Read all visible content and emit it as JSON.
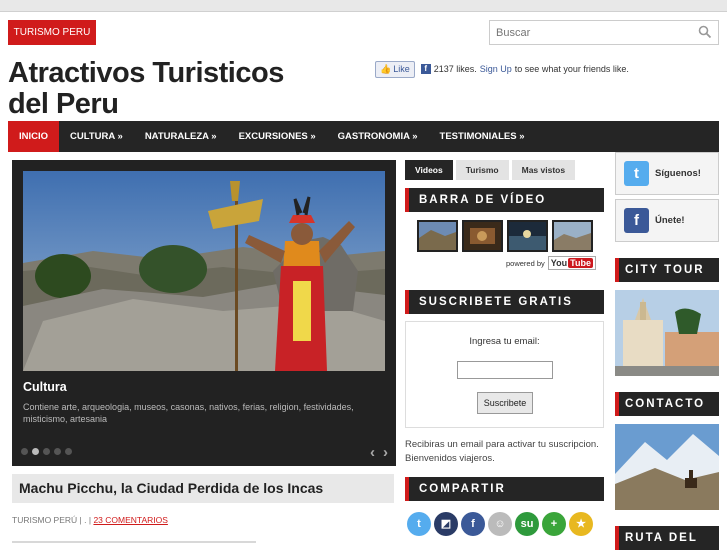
{
  "top_category": "TURISMO PERU",
  "search": {
    "placeholder": "Buscar"
  },
  "site": {
    "title_line1": "Atractivos Turisticos",
    "title_line2": "del Peru"
  },
  "facebook": {
    "like_label": "Like",
    "likes_text": "2137 likes.",
    "signup_label": "Sign Up",
    "signup_suffix": "to see what your friends like."
  },
  "nav": [
    {
      "label": "INICIO"
    },
    {
      "label": "CULTURA »"
    },
    {
      "label": "NATURALEZA »"
    },
    {
      "label": "EXCURSIONES »"
    },
    {
      "label": "GASTRONOMIA »"
    },
    {
      "label": "TESTIMONIALES »"
    }
  ],
  "slider": {
    "caption_title": "Cultura",
    "caption_text": "Contiene arte, arqueologia, museos, casonas, nativos, ferias, religion, festividades, misticismo, artesania",
    "prev_arrow": "‹",
    "next_arrow": "›",
    "current_slide": 2,
    "total_slides": 5
  },
  "post": {
    "title": "Machu Picchu, la Ciudad Perdida de los Incas",
    "category": "TURISMO PERÚ",
    "separator": "| . |",
    "comments": "23 COMENTARIOS"
  },
  "tabs": [
    {
      "label": "Videos"
    },
    {
      "label": "Turismo"
    },
    {
      "label": "Mas vistos"
    }
  ],
  "video_bar": {
    "title": "BARRA DE VÍDEO",
    "powered_by": "powered by",
    "yt_you": "You",
    "yt_tube": "Tube"
  },
  "subscribe": {
    "title": "SUSCRIBETE GRATIS",
    "email_label": "Ingresa tu email:",
    "button": "Suscribete",
    "note": "Recibiras un email para activar tu suscripcion. Bienvenidos viajeros."
  },
  "share": {
    "title": "COMPARTIR"
  },
  "right": {
    "twitter_label": "Síguenos!",
    "facebook_label": "Únete!",
    "city_tour": "CITY TOUR",
    "contacto": "CONTACTO",
    "ruta": "RUTA DEL"
  },
  "colors": {
    "accent": "#d01b1b",
    "bar": "#252525"
  }
}
